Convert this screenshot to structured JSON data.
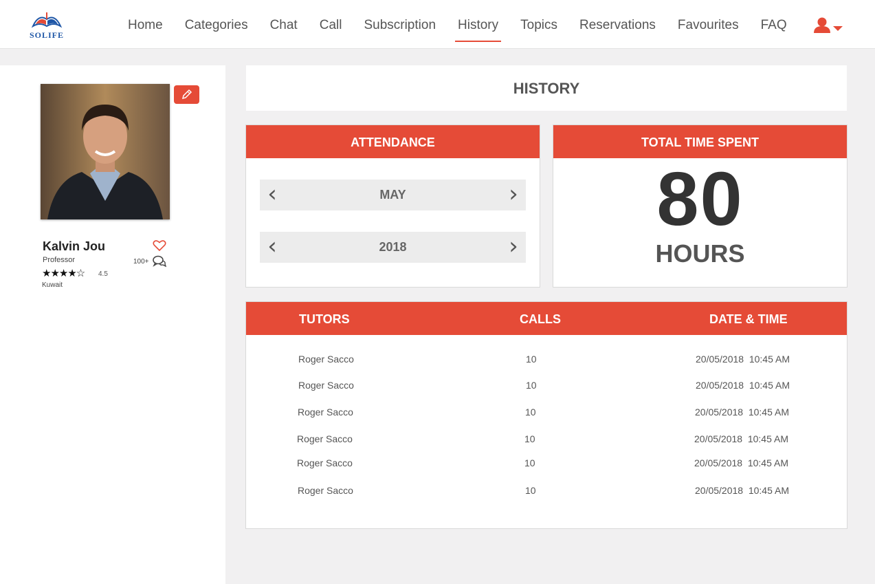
{
  "brand": {
    "name": "SOLIFE"
  },
  "nav": {
    "items": [
      {
        "label": "Home"
      },
      {
        "label": "Categories"
      },
      {
        "label": "Chat"
      },
      {
        "label": "Call"
      },
      {
        "label": "Subscription"
      },
      {
        "label": "History"
      },
      {
        "label": "Topics"
      },
      {
        "label": "Reservations"
      },
      {
        "label": "Favourites"
      },
      {
        "label": "FAQ"
      }
    ],
    "active": "History"
  },
  "profile": {
    "name": "Kalvin Jou",
    "role": "Professor",
    "stars": "★★★★☆",
    "rating": "4.5",
    "location": "Kuwait",
    "comments": "100+"
  },
  "page": {
    "title": "HISTORY"
  },
  "attendance": {
    "title": "ATTENDANCE",
    "month": "MAY",
    "year": "2018"
  },
  "total_time": {
    "title": "TOTAL TIME SPENT",
    "value": "80",
    "unit": "HOURS"
  },
  "table": {
    "headers": {
      "tutors": "TUTORS",
      "calls": "CALLS",
      "datetime": "DATE & TIME"
    },
    "rows": [
      {
        "tutor": "Roger Sacco",
        "calls": "10",
        "datetime": "20/05/2018  10:45 AM"
      },
      {
        "tutor": "Roger Sacco",
        "calls": "10",
        "datetime": "20/05/2018  10:45 AM"
      },
      {
        "tutor": "Roger Sacco",
        "calls": "10",
        "datetime": "20/05/2018  10:45 AM"
      },
      {
        "tutor": "Roger Sacco",
        "calls": "10",
        "datetime": "20/05/2018  10:45 AM"
      },
      {
        "tutor": "Roger Sacco",
        "calls": "10",
        "datetime": "20/05/2018  10:45 AM"
      },
      {
        "tutor": "Roger Sacco",
        "calls": "10",
        "datetime": "20/05/2018  10:45 AM"
      }
    ]
  },
  "colors": {
    "accent": "#e54b37",
    "brand_blue": "#1e56a6"
  }
}
